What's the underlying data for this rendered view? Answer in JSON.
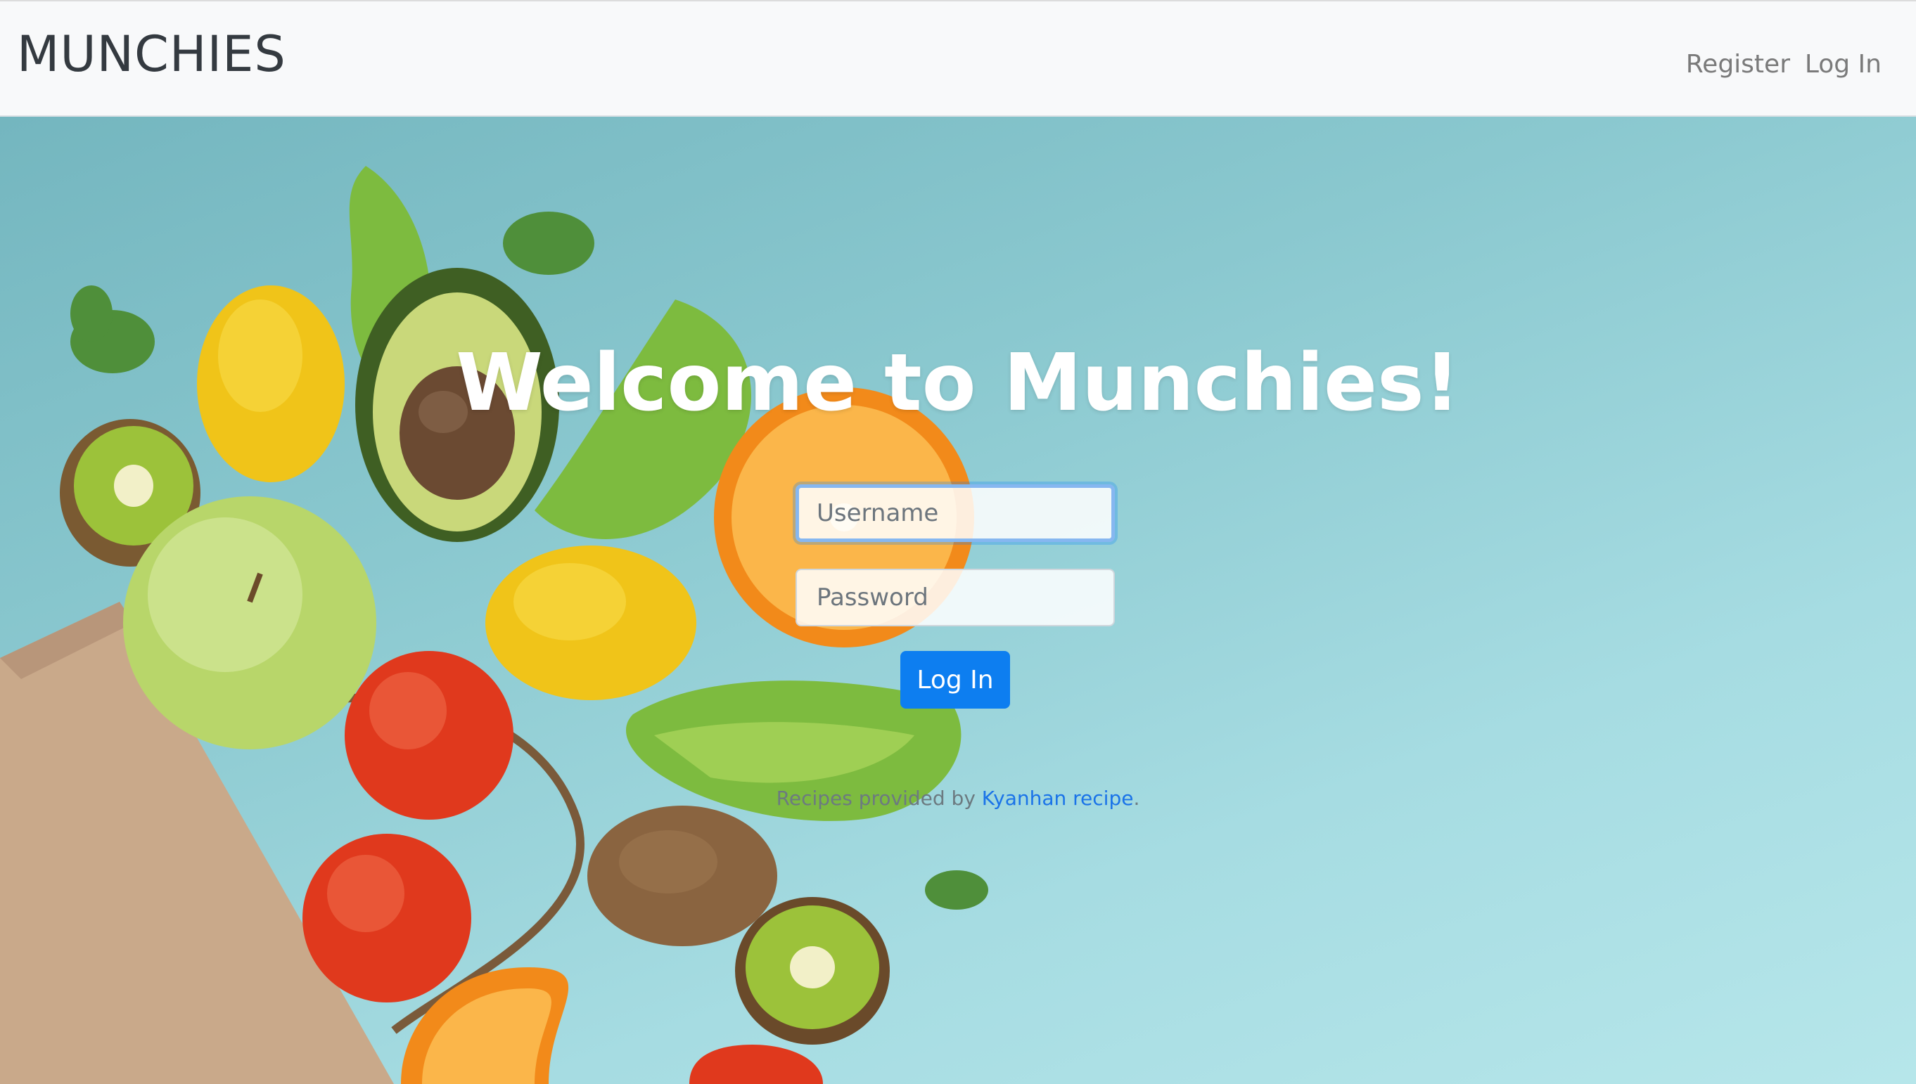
{
  "navbar": {
    "brand": "MUNCHIES",
    "links": [
      {
        "label": "Register"
      },
      {
        "label": "Log In"
      }
    ]
  },
  "hero": {
    "title": "Welcome to Munchies!",
    "form": {
      "username_placeholder": "Username",
      "password_placeholder": "Password",
      "submit_label": "Log In"
    },
    "credit": {
      "prefix": "Recipes provided by ",
      "link_text": "Kyanhan recipe",
      "suffix": "."
    }
  },
  "colors": {
    "primary": "#0d7ef0",
    "navbar_bg": "#f8f9fa",
    "background": "#9fd6dd"
  }
}
